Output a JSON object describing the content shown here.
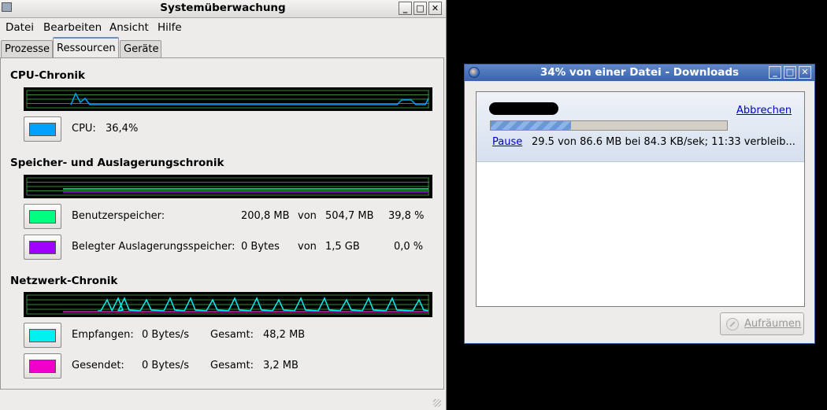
{
  "sysmon": {
    "title": "Systemüberwachung",
    "menu": [
      "Datei",
      "Bearbeiten",
      "Ansicht",
      "Hilfe"
    ],
    "tabs": [
      "Prozesse",
      "Ressourcen",
      "Geräte"
    ],
    "active_tab": "Ressourcen",
    "cpu": {
      "title": "CPU-Chronik",
      "label": "CPU:",
      "value": "36,4%",
      "color": "#00a0ff"
    },
    "memory": {
      "title": "Speicher- und Auslagerungschronik",
      "user": {
        "label": "Benutzerspeicher:",
        "used": "200,8 MB",
        "of": "von",
        "total": "504,7 MB",
        "percent": "39,8 %",
        "color": "#00ff80"
      },
      "swap": {
        "label": "Belegter Auslagerungsspeicher:",
        "used": "0 Bytes",
        "of": "von",
        "total": "1,5 GB",
        "percent": "0,0 %",
        "color": "#a000ff"
      }
    },
    "network": {
      "title": "Netzwerk-Chronik",
      "received": {
        "label": "Empfangen:",
        "rate": "0 Bytes/s",
        "total_label": "Gesamt:",
        "total": "48,2 MB",
        "color": "#00f0f0"
      },
      "sent": {
        "label": "Gesendet:",
        "rate": "0 Bytes/s",
        "total_label": "Gesamt:",
        "total": "3,2 MB",
        "color": "#f000c8"
      }
    }
  },
  "downloads": {
    "title": "34% von einer Datei - Downloads",
    "item": {
      "cancel": "Abbrechen",
      "pause": "Pause",
      "status": "29.5 von 86.6 MB bei 84.3 KB/sek; 11:33 verbleib...",
      "progress": 0.34
    },
    "clear_button": "Aufräumen"
  }
}
